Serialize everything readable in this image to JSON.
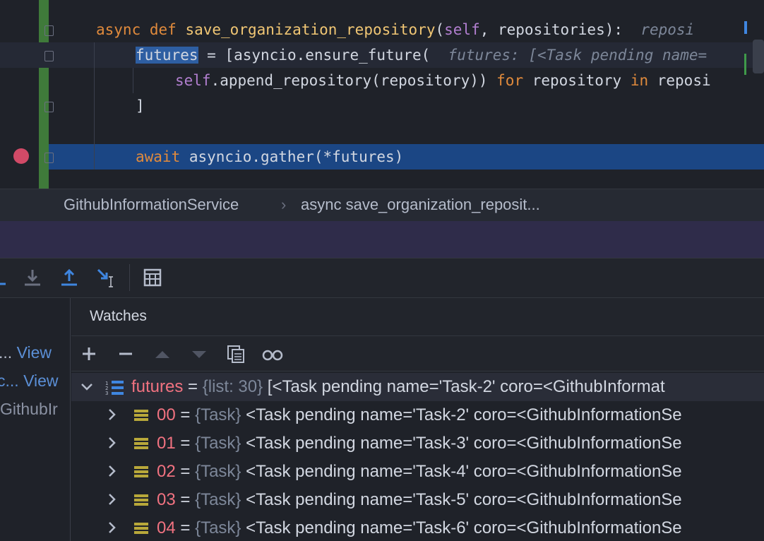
{
  "editor": {
    "line1": {
      "kw_async": "async",
      "kw_def": "def",
      "fn": "save_organization_repository",
      "paren_open": "(",
      "self": "self",
      "rest": ", repositories):",
      "inlay": "reposi"
    },
    "line2": {
      "futures": "futures",
      "rest": " = [asyncio.ensure_future(",
      "inlay": "futures: [<Task pending name="
    },
    "line3": {
      "self": "self",
      "mid": ".append_repository(repository)) ",
      "kw_for": "for",
      "mid2": " repository ",
      "kw_in": "in",
      "end": " reposi"
    },
    "line4": {
      "text": "]"
    },
    "line6": {
      "kw_await": "await",
      "rest": " asyncio.gather(*futures)"
    }
  },
  "breadcrumb": {
    "class_name": "GithubInformationService",
    "separator": "›",
    "method": "async save_organization_reposit..."
  },
  "left_panel": {
    "row1": {
      "prefix": "...",
      "link": "View"
    },
    "row2": {
      "prefix": "c...",
      "link": "View"
    },
    "row3": {
      "text": "GithubIr"
    }
  },
  "watches": {
    "title": "Watches",
    "root": {
      "name": "futures",
      "eq": " = ",
      "type": "{list: 30}",
      "value": " [<Task pending name='Task-2' coro=<GithubInformat"
    },
    "children": [
      {
        "name": "00",
        "eq": " = ",
        "type": "{Task}",
        "value": " <Task pending name='Task-2' coro=<GithubInformationSe"
      },
      {
        "name": "01",
        "eq": " = ",
        "type": "{Task}",
        "value": " <Task pending name='Task-3' coro=<GithubInformationSe"
      },
      {
        "name": "02",
        "eq": " = ",
        "type": "{Task}",
        "value": " <Task pending name='Task-4' coro=<GithubInformationSe"
      },
      {
        "name": "03",
        "eq": " = ",
        "type": "{Task}",
        "value": " <Task pending name='Task-5' coro=<GithubInformationSe"
      },
      {
        "name": "04",
        "eq": " = ",
        "type": "{Task}",
        "value": " <Task pending name='Task-6' coro=<GithubInformationSe"
      }
    ]
  },
  "icons": {
    "debug_toolbar": [
      "step-into-my-code-icon",
      "step-into-icon",
      "step-out-icon",
      "run-to-cursor-icon",
      "evaluate-expression-icon"
    ],
    "watch_toolbar": [
      "add-watch-icon",
      "remove-watch-icon",
      "move-up-icon",
      "move-down-icon",
      "copy-icon",
      "show-types-icon"
    ]
  },
  "colors": {
    "accent": "#5b8fd6",
    "breakpoint": "#d14a67",
    "execution_line": "#1b4684",
    "keyword": "#e08a3c",
    "var_name": "#f17280"
  }
}
